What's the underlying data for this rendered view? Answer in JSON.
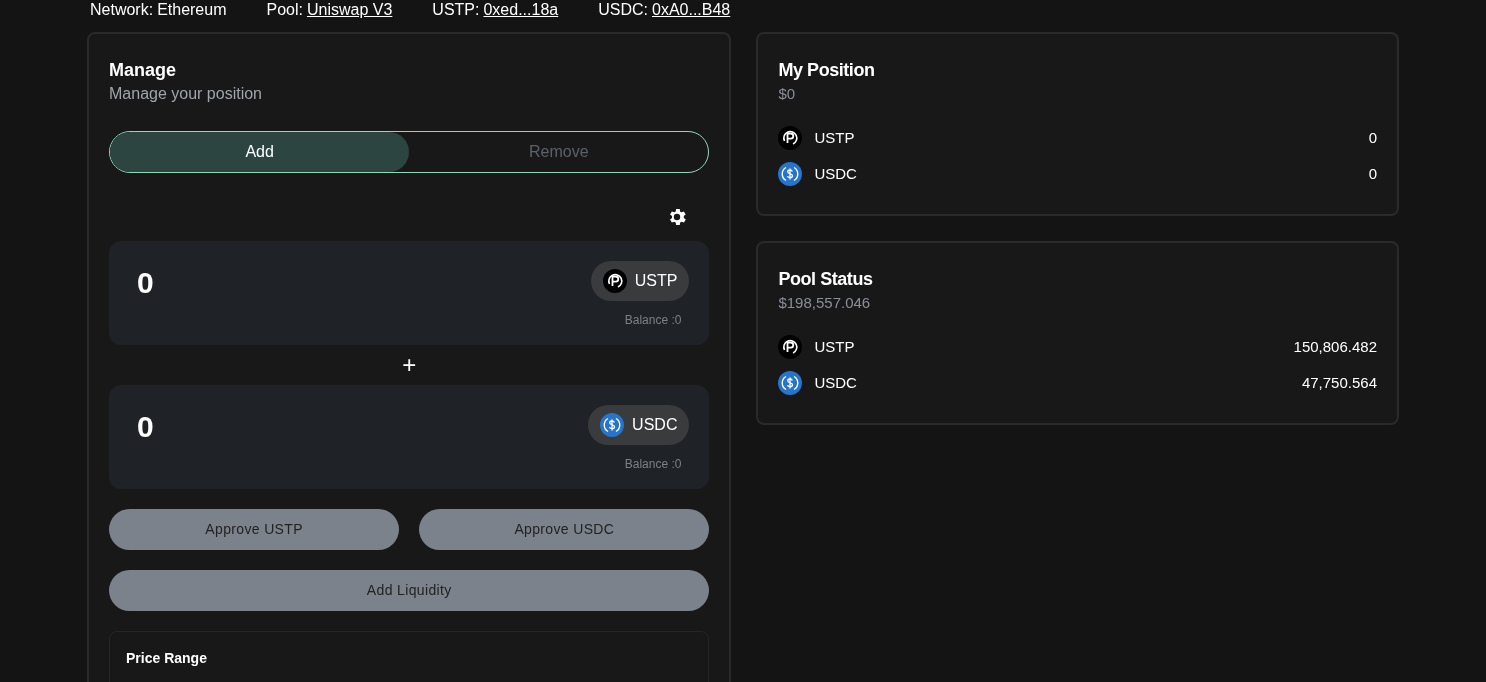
{
  "info_bar": [
    {
      "label": "Network:",
      "value": "Ethereum",
      "link": false
    },
    {
      "label": "Pool:",
      "value": "Uniswap V3",
      "link": true
    },
    {
      "label": "USTP:",
      "value": "0xed...18a",
      "link": true
    },
    {
      "label": "USDC:",
      "value": "0xA0...B48",
      "link": true
    }
  ],
  "manage": {
    "title": "Manage",
    "subtitle": "Manage your position",
    "tabs": [
      {
        "label": "Add",
        "selected": true
      },
      {
        "label": "Remove",
        "selected": false
      }
    ],
    "plus": "+",
    "inputs": [
      {
        "value": "0",
        "token": "USTP",
        "kind": "ustp",
        "balance": "Balance :0"
      },
      {
        "value": "0",
        "token": "USDC",
        "kind": "usdc",
        "balance": "Balance :0"
      }
    ],
    "approve_buttons": [
      {
        "label": "Approve USTP",
        "disabled": true
      },
      {
        "label": "Approve USDC",
        "disabled": true
      }
    ],
    "submit": {
      "label": "Add Liquidity",
      "disabled": true
    },
    "price_range": {
      "title": "Price Range"
    }
  },
  "cards": [
    {
      "title": "My Position",
      "total": "$0",
      "tokens": [
        {
          "name": "USTP",
          "kind": "ustp",
          "amount": "0"
        },
        {
          "name": "USDC",
          "kind": "usdc",
          "amount": "0"
        }
      ]
    },
    {
      "title": "Pool Status",
      "total": "$198,557.046",
      "tokens": [
        {
          "name": "USTP",
          "kind": "ustp",
          "amount": "150,806.482"
        },
        {
          "name": "USDC",
          "kind": "usdc",
          "amount": "47,750.564"
        }
      ]
    }
  ]
}
